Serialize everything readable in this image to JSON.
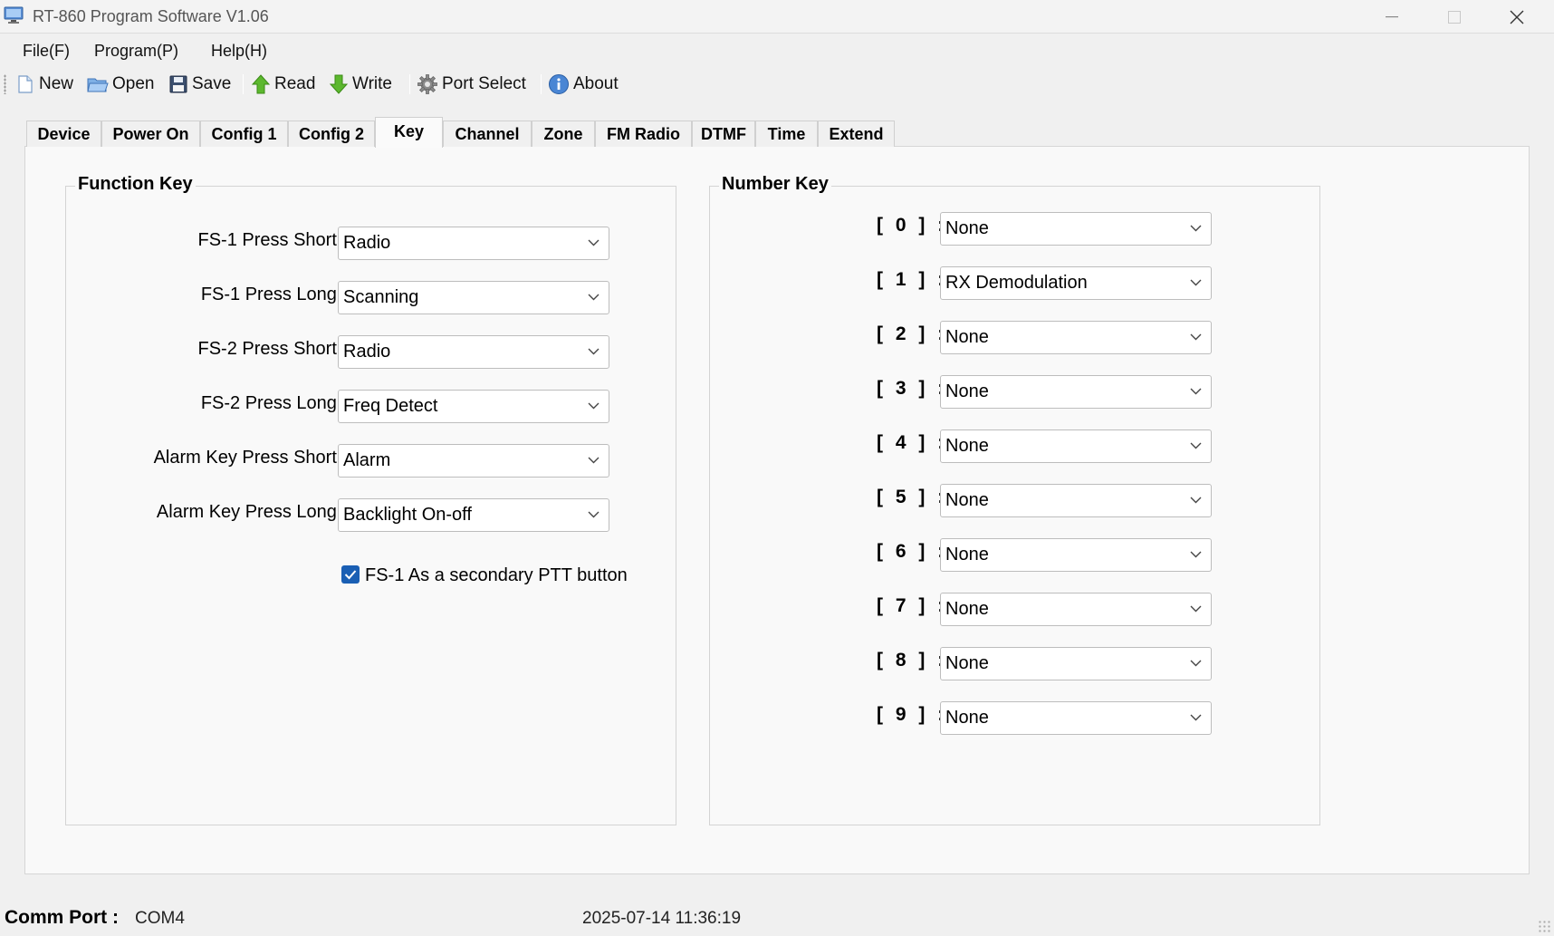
{
  "window": {
    "title": "RT-860 Program Software V1.06",
    "icon": "computer-icon"
  },
  "menu": [
    {
      "label": "File(F)"
    },
    {
      "label": "Program(P)"
    },
    {
      "label": "Help(H)"
    }
  ],
  "toolbar": {
    "new_label": "New",
    "open_label": "Open",
    "save_label": "Save",
    "read_label": "Read",
    "write_label": "Write",
    "port_select_label": "Port Select",
    "about_label": "About"
  },
  "tabs": [
    {
      "label": "Device"
    },
    {
      "label": "Power On"
    },
    {
      "label": "Config 1"
    },
    {
      "label": "Config 2"
    },
    {
      "label": "Key"
    },
    {
      "label": "Channel"
    },
    {
      "label": "Zone"
    },
    {
      "label": "FM Radio"
    },
    {
      "label": "DTMF"
    },
    {
      "label": "Time"
    },
    {
      "label": "Extend"
    }
  ],
  "active_tab": "Key",
  "function_key": {
    "title": "Function Key",
    "rows": [
      {
        "label": "FS-1 Press Short :",
        "value": "Radio"
      },
      {
        "label": "FS-1 Press Long :",
        "value": "Scanning"
      },
      {
        "label": "FS-2 Press Short :",
        "value": "Radio"
      },
      {
        "label": "FS-2 Press Long :",
        "value": "Freq Detect"
      },
      {
        "label": "Alarm Key Press Short :",
        "value": "Alarm"
      },
      {
        "label": "Alarm Key Press Long :",
        "value": "Backlight On-off"
      }
    ],
    "checkbox_label": "FS-1 As a secondary PTT button",
    "checkbox_checked": true
  },
  "number_key": {
    "title": "Number Key",
    "rows": [
      {
        "label": "[ 0 ] :",
        "value": "None"
      },
      {
        "label": "[ 1 ] :",
        "value": "RX Demodulation"
      },
      {
        "label": "[ 2 ] :",
        "value": "None"
      },
      {
        "label": "[ 3 ] :",
        "value": "None"
      },
      {
        "label": "[ 4 ] :",
        "value": "None"
      },
      {
        "label": "[ 5 ] :",
        "value": "None"
      },
      {
        "label": "[ 6 ] :",
        "value": "None"
      },
      {
        "label": "[ 7 ] :",
        "value": "None"
      },
      {
        "label": "[ 8 ] :",
        "value": "None"
      },
      {
        "label": "[ 9 ] :",
        "value": "None"
      }
    ]
  },
  "status": {
    "comm_port_label": "Comm Port :",
    "comm_port_value": "COM4",
    "datetime": "2025-07-14 11:36:19"
  },
  "colors": {
    "accent": "#1a5fb4",
    "window_bg": "#f0f0f0",
    "page_bg": "#f9f9f9"
  }
}
